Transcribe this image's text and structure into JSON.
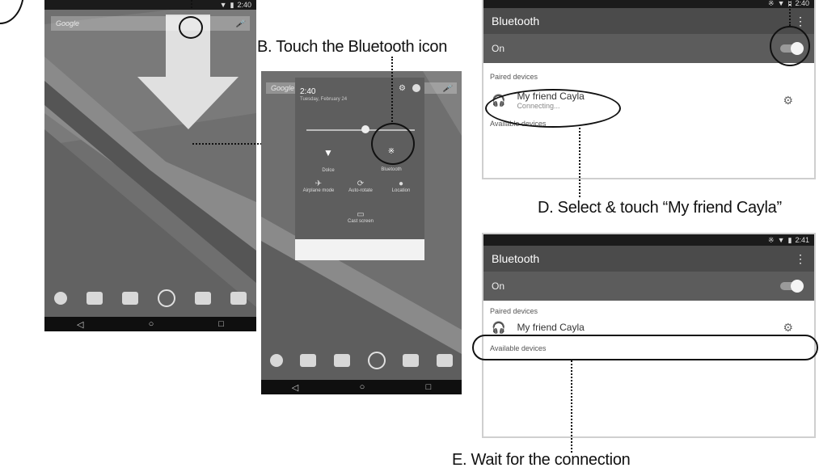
{
  "captions": {
    "b": "B. Touch the Bluetooth icon",
    "d": "D. Select & touch “My friend Cayla”",
    "e": "E. Wait for the connection"
  },
  "home": {
    "search_text": "Google",
    "status_time": "2:40",
    "nav": [
      "◁",
      "○",
      "□"
    ]
  },
  "quick_settings": {
    "time": "2:40",
    "date": "Tuesday, February 24",
    "tiles": [
      "Dolce",
      "Bluetooth",
      "Airplane mode",
      "Auto-rotate",
      "Location",
      "Cast screen"
    ],
    "nav": [
      "◁",
      "○",
      "□"
    ],
    "search_text": "Google"
  },
  "bt_screen_1": {
    "status_time": "2:40",
    "title": "Bluetooth",
    "menu": "⋮",
    "on_label": "On",
    "paired_label": "Paired devices",
    "device_name": "My friend Cayla",
    "device_status": "Connecting...",
    "available_label": "Available devices"
  },
  "bt_screen_2": {
    "status_time": "2:41",
    "title": "Bluetooth",
    "menu": "⋮",
    "on_label": "On",
    "paired_label": "Paired devices",
    "device_name": "My friend Cayla",
    "available_label": "Available devices"
  },
  "colors": {
    "wallpaper": "#6d6d6d",
    "header": "#4b4b4b",
    "on_row": "#5c5c5c",
    "statusbar": "#1b1b1b"
  }
}
